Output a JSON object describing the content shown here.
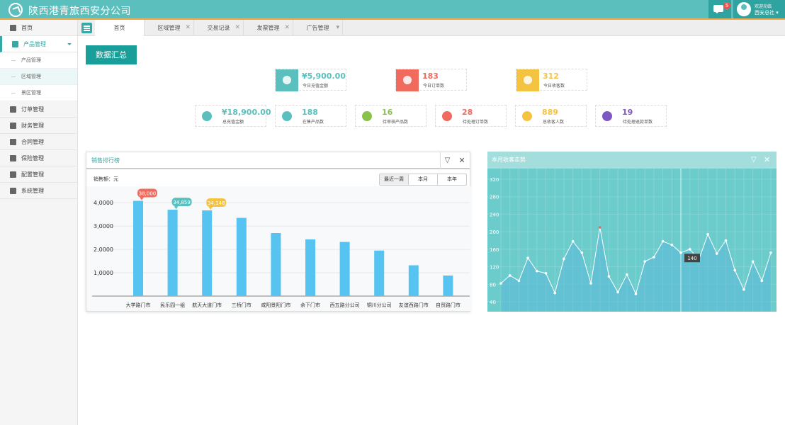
{
  "header": {
    "title": "陕西港青旅西安分公司",
    "msg_count": "5",
    "welcome": "欢迎光临",
    "user": "西安总社 ▾"
  },
  "sidebar": {
    "items": [
      {
        "label": "首页",
        "icon": "home-icon"
      },
      {
        "label": "产品管理",
        "icon": "product-icon",
        "active": true,
        "children": [
          {
            "label": "产品管理"
          },
          {
            "label": "区域管理"
          },
          {
            "label": "景区管理"
          }
        ]
      },
      {
        "label": "订单管理",
        "icon": "order-icon"
      },
      {
        "label": "财务管理",
        "icon": "wallet-icon"
      },
      {
        "label": "合同管理",
        "icon": "contract-icon"
      },
      {
        "label": "保险管理",
        "icon": "insurance-icon"
      },
      {
        "label": "配置管理",
        "icon": "sliders-icon"
      },
      {
        "label": "系统管理",
        "icon": "monitor-icon"
      }
    ]
  },
  "tabs": [
    {
      "label": "首页",
      "closable": false,
      "active": true
    },
    {
      "label": "区域管理",
      "closable": true
    },
    {
      "label": "交易记录",
      "closable": true
    },
    {
      "label": "发票管理",
      "closable": true
    },
    {
      "label": "广告管理",
      "closable": false,
      "dropdown": true
    }
  ],
  "main": {
    "title": "数据汇总",
    "stats_row1": [
      {
        "value": "¥5,900.00",
        "label": "今日充值金额",
        "color": "#5bc0bd",
        "icon": "money-bag-icon"
      },
      {
        "value": "183",
        "label": "今日订单数",
        "color": "#f06a5e",
        "icon": "clipboard-icon"
      },
      {
        "value": "312",
        "label": "今日收客数",
        "color": "#f5c342",
        "icon": "user-icon"
      }
    ],
    "stats_row2": [
      {
        "value": "¥18,900.00",
        "label": "总充值金额",
        "color": "#5bc0bd",
        "icon": "money-bag-icon"
      },
      {
        "value": "188",
        "label": "在售产品数",
        "color": "#5bc0bd",
        "icon": "grid-dots-icon"
      },
      {
        "value": "16",
        "label": "待审核产品数",
        "color": "#8bc34a",
        "icon": "pending-products-icon"
      },
      {
        "value": "28",
        "label": "待处理订单数",
        "color": "#f06a5e",
        "icon": "pending-orders-icon"
      },
      {
        "value": "889",
        "label": "总收客人数",
        "color": "#f5c342",
        "icon": "users-icon"
      },
      {
        "value": "19",
        "label": "待处理退款单数",
        "color": "#7e57c2",
        "icon": "refund-icon"
      }
    ]
  },
  "sales_panel": {
    "title": "销售排行榜",
    "unit_label": "销售额：元",
    "ranges": [
      "最近一周",
      "本月",
      "本年"
    ],
    "active_range": "最近一周"
  },
  "trend_panel": {
    "title": "本月收客走势",
    "tooltip": "140"
  },
  "chart_data": [
    {
      "type": "bar",
      "title": "销售排行榜",
      "ylabel": "销售额：元",
      "categories": [
        "大学路门市",
        "民乐园一组",
        "航天大道门市",
        "三桥门市",
        "咸阳景阳门市",
        "余下门市",
        "西五路分公司",
        "铜川分公司",
        "友谊西路门市",
        "自贸路门市"
      ],
      "values": [
        40800,
        37000,
        36700,
        33500,
        27000,
        24300,
        23200,
        19500,
        13200,
        8800
      ],
      "yticks": [
        "1,0000",
        "2,0000",
        "3,0000",
        "4,0000"
      ],
      "ylim": [
        0,
        44000
      ],
      "annotations": [
        {
          "index": 0,
          "text": "38,000",
          "color": "#f06a5e"
        },
        {
          "index": 1,
          "text": "34,859",
          "color": "#5bc0bd"
        },
        {
          "index": 2,
          "text": "34,148",
          "color": "#f5c342"
        }
      ]
    },
    {
      "type": "area",
      "title": "本月收客走势",
      "ylim": [
        20,
        330
      ],
      "yticks": [
        40,
        80,
        120,
        160,
        200,
        240,
        280,
        320
      ],
      "values": [
        82,
        100,
        88,
        140,
        110,
        105,
        60,
        138,
        178,
        152,
        82,
        210,
        98,
        62,
        102,
        58,
        132,
        142,
        178,
        170,
        152,
        160,
        136,
        194,
        150,
        180,
        112,
        68,
        132,
        88,
        152
      ],
      "highlight_index": 23,
      "red_point_index": 11
    }
  ]
}
